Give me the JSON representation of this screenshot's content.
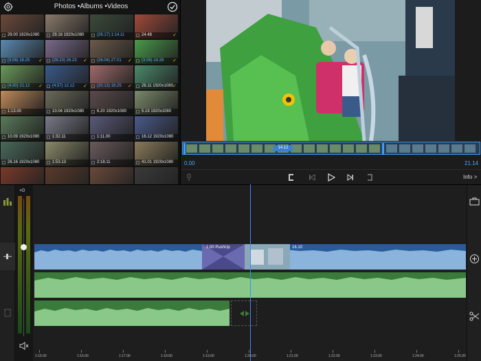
{
  "browser": {
    "title": "Photos •Albums •Videos",
    "settings_icon": "gear-icon",
    "done_icon": "checkmark-circle-icon",
    "thumbnails": [
      {
        "caption": "29.00  1920x1080",
        "highlight": false,
        "check": false,
        "color": "#6a4a3a"
      },
      {
        "caption": "29.16  1920x1080",
        "highlight": false,
        "check": false,
        "color": "#8a7a6a"
      },
      {
        "caption": "(26.17)  1:14.11",
        "highlight": true,
        "check": false,
        "color": "#3a4a3a"
      },
      {
        "caption": "  24.48",
        "highlight": false,
        "check": true,
        "color": "#a04a3a"
      },
      {
        "caption": "(3.06)  18.25",
        "highlight": true,
        "check": true,
        "color": "#5a8ab0"
      },
      {
        "caption": "(26.23)  26.23",
        "highlight": true,
        "check": true,
        "color": "#7a6a8a"
      },
      {
        "caption": "(26.04)  27.01",
        "highlight": true,
        "check": true,
        "color": "#6a5a4a"
      },
      {
        "caption": "(3.06)  14.28",
        "highlight": true,
        "check": true,
        "color": "#4a9a4a"
      },
      {
        "caption": "(4.30)  21.12",
        "highlight": true,
        "check": true,
        "color": "#6a9a5a"
      },
      {
        "caption": "(4.57)  12.12",
        "highlight": true,
        "check": true,
        "color": "#3a5a8a"
      },
      {
        "caption": "(20.13)  18.25",
        "highlight": true,
        "check": true,
        "color": "#a06a6a"
      },
      {
        "caption": "28.11  1920x1080",
        "highlight": false,
        "check": true,
        "color": "#4a8a6a"
      },
      {
        "caption": "1:13.00",
        "highlight": false,
        "check": false,
        "color": "#c08a5a"
      },
      {
        "caption": "10.04  1920x1080",
        "highlight": false,
        "check": false,
        "color": "#6a6a5a"
      },
      {
        "caption": "6.20  1920x1080",
        "highlight": false,
        "check": false,
        "color": "#5a4a4a"
      },
      {
        "caption": "5.19  1920x1080",
        "highlight": false,
        "check": false,
        "color": "#7a8a6a"
      },
      {
        "caption": "10.09  1920x1080",
        "highlight": false,
        "check": false,
        "color": "#5a7a5a"
      },
      {
        "caption": "1:32.11",
        "highlight": false,
        "check": false,
        "color": "#7a7a8a"
      },
      {
        "caption": "1:11.00",
        "highlight": false,
        "check": false,
        "color": "#5a5a7a"
      },
      {
        "caption": "16.12  1920x1080",
        "highlight": false,
        "check": false,
        "color": "#4a5a8a"
      },
      {
        "caption": "26.16  1920x1080",
        "highlight": false,
        "check": false,
        "color": "#4a6a5a"
      },
      {
        "caption": "1:53.13",
        "highlight": false,
        "check": false,
        "color": "#8a8a6a"
      },
      {
        "caption": "2:18.11",
        "highlight": false,
        "check": false,
        "color": "#6a5a5a"
      },
      {
        "caption": "41.01  1920x1080",
        "highlight": false,
        "check": false,
        "color": "#8a7a5a"
      },
      {
        "caption": "",
        "highlight": false,
        "check": false,
        "color": "#7a3a2a"
      },
      {
        "caption": "",
        "highlight": false,
        "check": false,
        "color": "#5a3a2a"
      },
      {
        "caption": "",
        "highlight": false,
        "check": false,
        "color": "#6a4a3a"
      },
      {
        "caption": "",
        "highlight": false,
        "check": false,
        "color": "#3a3a3a"
      }
    ]
  },
  "viewer": {
    "scrub_badge": "14.12",
    "time_start": "0.00",
    "time_end": "21.14",
    "info_label": "Info >"
  },
  "timeline": {
    "db_label": "+0",
    "pushup_label": "1.00    PushUp",
    "clip_duration": "16.10",
    "volume_level": 0.65,
    "ruler": [
      "1:15.00",
      "1:16.00",
      "1:17.00",
      "1:18.00",
      "1:19.00",
      "1:20.00",
      "1:21.00",
      "1:22.00",
      "1:23.00",
      "1:24.00",
      "1:25.00"
    ]
  }
}
